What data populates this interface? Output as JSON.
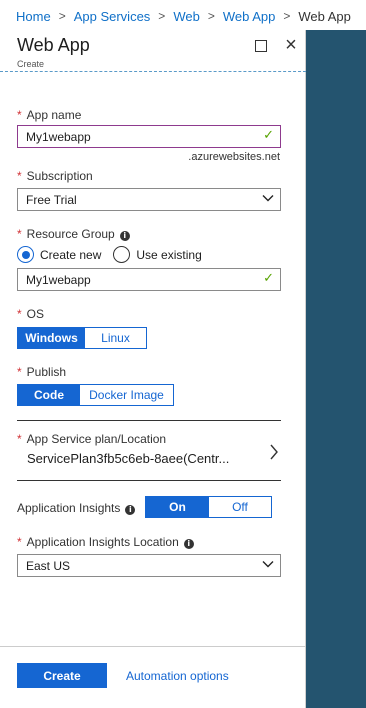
{
  "breadcrumb": {
    "items": [
      "Home",
      "App Services",
      "Web",
      "Web App",
      "Web App"
    ],
    "separator": ">"
  },
  "blade": {
    "title": "Web App",
    "subtitle": "Create"
  },
  "form": {
    "app_name": {
      "label": "App name",
      "value": "My1webapp",
      "suffix": ".azurewebsites.net",
      "required_marker": "*"
    },
    "subscription": {
      "label": "Subscription",
      "value": "Free Trial",
      "required_marker": "*"
    },
    "resource_group": {
      "label": "Resource Group",
      "options": [
        "Create new",
        "Use existing"
      ],
      "selected": "Create new",
      "value": "My1webapp",
      "required_marker": "*"
    },
    "os": {
      "label": "OS",
      "options": [
        "Windows",
        "Linux"
      ],
      "selected": "Windows",
      "required_marker": "*"
    },
    "publish": {
      "label": "Publish",
      "options": [
        "Code",
        "Docker Image"
      ],
      "selected": "Code",
      "required_marker": "*"
    },
    "app_service_plan": {
      "label": "App Service plan/Location",
      "value": "ServicePlan3fb5c6eb-8aee(Centr...",
      "required_marker": "*"
    },
    "application_insights": {
      "label": "Application Insights",
      "options": [
        "On",
        "Off"
      ],
      "selected": "On"
    },
    "insights_location": {
      "label": "Application Insights Location",
      "value": "East US",
      "required_marker": "*"
    }
  },
  "footer": {
    "create_label": "Create",
    "automation_label": "Automation options"
  },
  "icons": {
    "info": "i",
    "check": "✓",
    "close": "×"
  },
  "colors": {
    "accent": "#1566d2",
    "link": "#1070c8",
    "required": "#d13438",
    "valid": "#57a300",
    "active_border": "#8e3a8e",
    "side_panel": "#24546f"
  }
}
